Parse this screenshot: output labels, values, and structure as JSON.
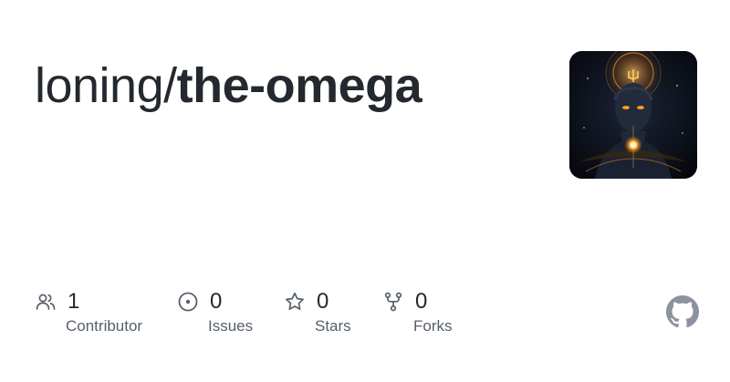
{
  "repo": {
    "owner": "loning/",
    "name": "the-omega"
  },
  "avatar": {
    "icon": "cosmic-figure-avatar"
  },
  "stats": [
    {
      "icon": "people-icon",
      "count": "1",
      "label": "Contributor"
    },
    {
      "icon": "issue-circle-icon",
      "count": "0",
      "label": "Issues"
    },
    {
      "icon": "star-icon",
      "count": "0",
      "label": "Stars"
    },
    {
      "icon": "fork-icon",
      "count": "0",
      "label": "Forks"
    }
  ],
  "brand": {
    "icon": "github-mark-icon"
  },
  "colors": {
    "text": "#24292f",
    "muted": "#57606a",
    "icon": "#57606a",
    "brand_mark": "#8b949e",
    "avatar_glow": "#f0a030"
  }
}
